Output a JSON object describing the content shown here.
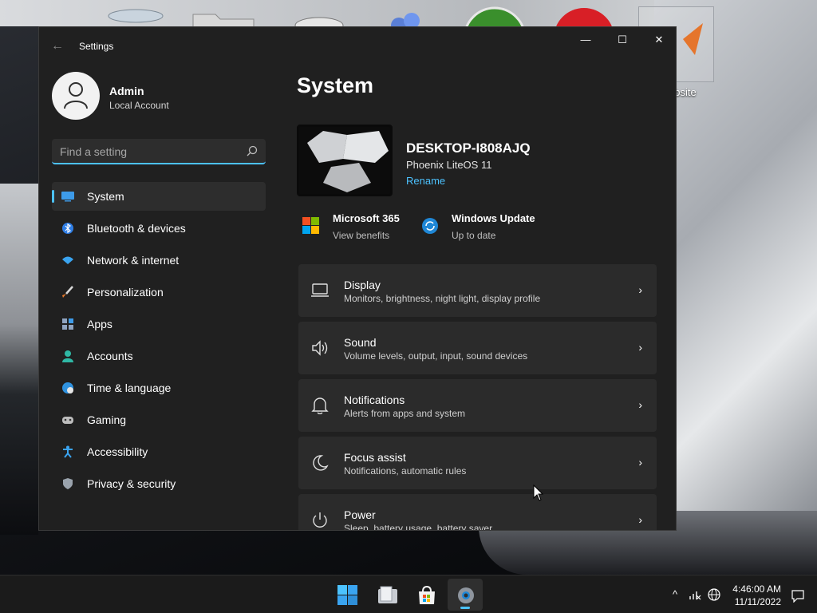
{
  "desktop": {
    "shortcut_label": "ebsite"
  },
  "window": {
    "title": "Settings",
    "controls": {
      "back": "←",
      "minimize": "—",
      "maximize": "☐",
      "close": "✕"
    }
  },
  "profile": {
    "name": "Admin",
    "account_type": "Local Account"
  },
  "search": {
    "placeholder": "Find a setting"
  },
  "nav": {
    "items": [
      {
        "label": "System",
        "icon": "monitor-icon",
        "active": true
      },
      {
        "label": "Bluetooth & devices",
        "icon": "bluetooth-icon"
      },
      {
        "label": "Network & internet",
        "icon": "wifi-icon"
      },
      {
        "label": "Personalization",
        "icon": "brush-icon"
      },
      {
        "label": "Apps",
        "icon": "apps-icon"
      },
      {
        "label": "Accounts",
        "icon": "person-icon"
      },
      {
        "label": "Time & language",
        "icon": "globe-clock-icon"
      },
      {
        "label": "Gaming",
        "icon": "controller-icon"
      },
      {
        "label": "Accessibility",
        "icon": "accessibility-icon"
      },
      {
        "label": "Privacy & security",
        "icon": "shield-icon"
      }
    ]
  },
  "main": {
    "title": "System",
    "device": {
      "name": "DESKTOP-I808AJQ",
      "os": "Phoenix LiteOS 11",
      "rename": "Rename"
    },
    "promos": [
      {
        "title": "Microsoft 365",
        "subtitle": "View benefits",
        "icon": "microsoft-logo-icon"
      },
      {
        "title": "Windows Update",
        "subtitle": "Up to date",
        "icon": "sync-icon"
      }
    ],
    "cards": [
      {
        "title": "Display",
        "subtitle": "Monitors, brightness, night light, display profile",
        "icon": "laptop-icon"
      },
      {
        "title": "Sound",
        "subtitle": "Volume levels, output, input, sound devices",
        "icon": "speaker-icon"
      },
      {
        "title": "Notifications",
        "subtitle": "Alerts from apps and system",
        "icon": "bell-icon"
      },
      {
        "title": "Focus assist",
        "subtitle": "Notifications, automatic rules",
        "icon": "moon-icon"
      },
      {
        "title": "Power",
        "subtitle": "Sleep, battery usage, battery saver",
        "icon": "power-icon"
      }
    ],
    "chevron": "›"
  },
  "taskbar": {
    "apps": [
      "start-icon",
      "file-explorer-icon",
      "store-icon",
      "settings-icon"
    ],
    "tray": {
      "chevron": "^",
      "time": "4:46:00 AM",
      "date": "11/11/2022"
    }
  },
  "colors": {
    "accent": "#4cc2ff",
    "window_bg": "#202020",
    "card_bg": "#2b2b2b"
  }
}
